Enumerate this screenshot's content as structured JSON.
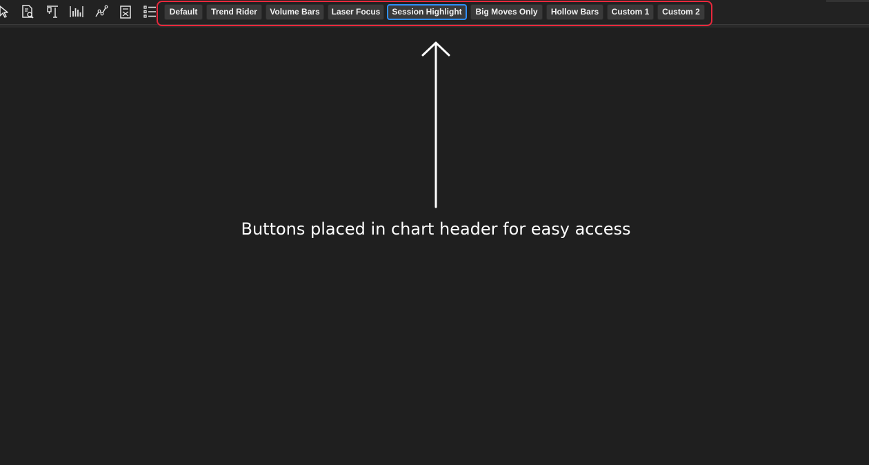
{
  "toolbar": {
    "icons": [
      "cursor-icon",
      "find-document-icon",
      "layout-columns-icon",
      "bar-chart-icon",
      "line-chart-icon",
      "calculator-icon",
      "list-icon"
    ]
  },
  "template_buttons": [
    {
      "label": "Default",
      "active": false
    },
    {
      "label": "Trend Rider",
      "active": false
    },
    {
      "label": "Volume Bars",
      "active": false
    },
    {
      "label": "Laser Focus",
      "active": false
    },
    {
      "label": "Session Highlight",
      "active": true
    },
    {
      "label": "Big Moves Only",
      "active": false
    },
    {
      "label": "Hollow Bars",
      "active": false
    },
    {
      "label": "Custom 1",
      "active": false
    },
    {
      "label": "Custom 2",
      "active": false
    }
  ],
  "annotation": {
    "caption": "Buttons placed in chart header for easy access",
    "highlight_color": "#e8283c",
    "active_border_color": "#2f8fff"
  }
}
